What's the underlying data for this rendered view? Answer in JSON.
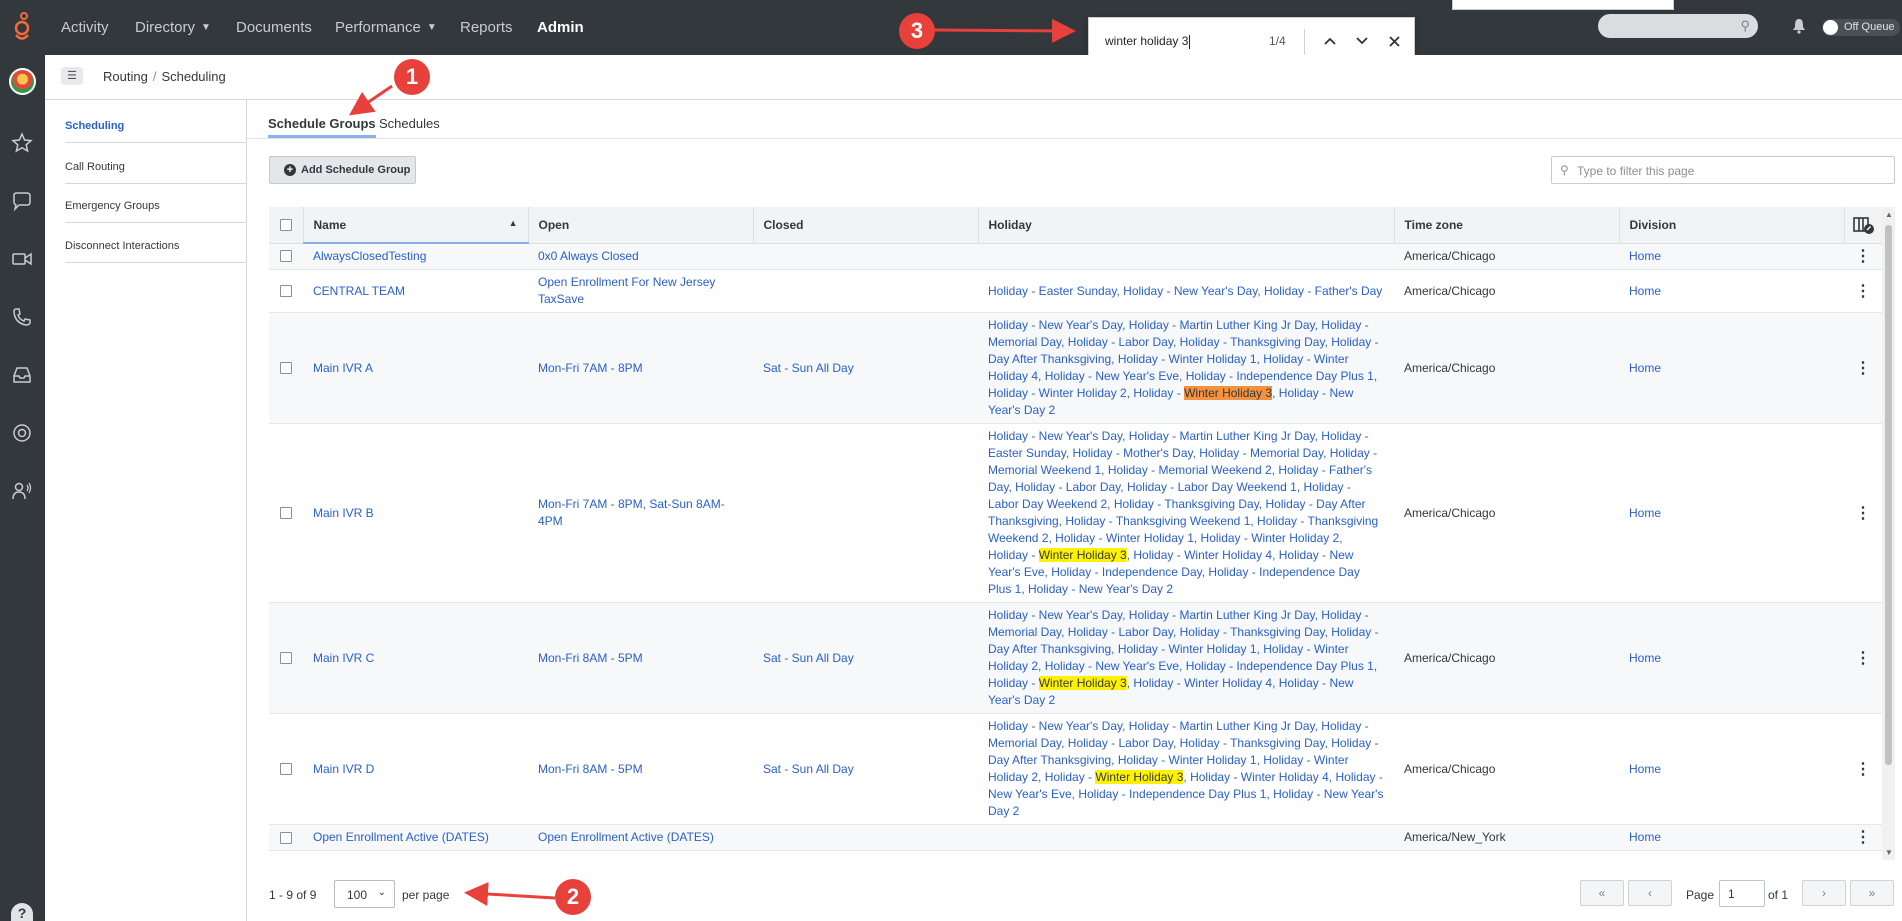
{
  "topnav": {
    "items": [
      {
        "label": "Activity",
        "has_caret": false
      },
      {
        "label": "Directory",
        "has_caret": true
      },
      {
        "label": "Documents",
        "has_caret": false
      },
      {
        "label": "Performance",
        "has_caret": true
      },
      {
        "label": "Reports",
        "has_caret": false
      },
      {
        "label": "Admin",
        "has_caret": false,
        "active": true
      }
    ],
    "queue_toggle_label": "Off Queue"
  },
  "find_bar": {
    "query": "winter holiday 3",
    "match_count": "1/4",
    "icons": [
      "chevron-up-icon",
      "chevron-down-icon",
      "close-icon"
    ]
  },
  "left_rail_icons": [
    "star-icon",
    "chat-icon",
    "video-icon",
    "phone-icon",
    "inbox-icon",
    "lifebuoy-icon",
    "user-voice-icon",
    "help-icon"
  ],
  "breadcrumb": [
    "Routing",
    "Scheduling"
  ],
  "sidenav": {
    "items": [
      {
        "label": "Scheduling",
        "active": true
      },
      {
        "label": "Call Routing"
      },
      {
        "label": "Emergency Groups"
      },
      {
        "label": "Disconnect Interactions"
      }
    ]
  },
  "tabs": [
    {
      "label": "Schedule Groups",
      "active": true
    },
    {
      "label": "Schedules"
    }
  ],
  "toolbar": {
    "add_label": "Add Schedule Group",
    "filter_placeholder": "Type to filter this page"
  },
  "table": {
    "columns": [
      "Name",
      "Open",
      "Closed",
      "Holiday",
      "Time zone",
      "Division"
    ],
    "rows": [
      {
        "name": "AlwaysClosedTesting",
        "open": "0x0 Always Closed",
        "closed": "",
        "holiday": [
          ""
        ],
        "timezone": "America/Chicago",
        "division": "Home"
      },
      {
        "name": "CENTRAL TEAM",
        "open": "Open Enrollment For New Jersey TaxSave",
        "closed": "",
        "holiday": [
          "Holiday - Easter Sunday, Holiday - New Year's Day, Holiday - Father's Day"
        ],
        "timezone": "America/Chicago",
        "division": "Home"
      },
      {
        "name": "Main IVR A",
        "open": "Mon-Fri 7AM - 8PM",
        "closed": "Sat - Sun All Day",
        "holiday": [
          "Holiday - New Year's Day, Holiday - Martin Luther King Jr Day, Holiday - Memorial Day, Holiday - Labor Day, Holiday - Thanksgiving Day, Holiday - Day After Thanksgiving, Holiday - Winter Holiday 1, Holiday - Winter Holiday 4, Holiday - New Year's Eve, Holiday - Independence Day Plus 1, Holiday - Winter Holiday 2, Holiday - ",
          "Winter Holiday 3",
          ", Holiday - New Year's Day 2"
        ],
        "highlight": "current",
        "timezone": "America/Chicago",
        "division": "Home"
      },
      {
        "name": "Main IVR B",
        "open": "Mon-Fri 7AM - 8PM, Sat-Sun 8AM-4PM",
        "closed": "",
        "holiday": [
          "Holiday - New Year's Day, Holiday - Martin Luther King Jr Day, Holiday - Easter Sunday, Holiday - Mother's Day, Holiday - Memorial Day, Holiday - Memorial Weekend 1, Holiday - Memorial Weekend 2, Holiday - Father's Day, Holiday - Labor Day, Holiday - Labor Day Weekend 1, Holiday - Labor Day Weekend 2, Holiday - Thanksgiving Day, Holiday - Day After Thanksgiving, Holiday - Thanksgiving Weekend 1, Holiday - Thanksgiving Weekend 2, Holiday - Winter Holiday 1, Holiday - Winter Holiday 2, Holiday - ",
          "Winter Holiday 3",
          ", Holiday - Winter Holiday 4, Holiday - New Year's Eve, Holiday - Independence Day, Holiday - Independence Day Plus 1, Holiday - New Year's Day 2"
        ],
        "highlight": "match",
        "timezone": "America/Chicago",
        "division": "Home"
      },
      {
        "name": "Main IVR C",
        "open": "Mon-Fri 8AM - 5PM",
        "closed": "Sat - Sun All Day",
        "holiday": [
          "Holiday - New Year's Day, Holiday - Martin Luther King Jr Day, Holiday - Memorial Day, Holiday - Labor Day, Holiday - Thanksgiving Day, Holiday - Day After Thanksgiving, Holiday - Winter Holiday 1, Holiday - Winter Holiday 2, Holiday - New Year's Eve, Holiday - Independence Day Plus 1, Holiday - ",
          "Winter Holiday 3",
          ", Holiday - Winter Holiday 4, Holiday - New Year's Day 2"
        ],
        "highlight": "match",
        "timezone": "America/Chicago",
        "division": "Home"
      },
      {
        "name": "Main IVR D",
        "open": "Mon-Fri 8AM - 5PM",
        "closed": "Sat - Sun All Day",
        "holiday": [
          "Holiday - New Year's Day, Holiday - Martin Luther King Jr Day, Holiday - Memorial Day, Holiday - Labor Day, Holiday - Thanksgiving Day, Holiday - Day After Thanksgiving, Holiday - Winter Holiday 1, Holiday - Winter Holiday 2, Holiday - ",
          "Winter Holiday 3",
          ", Holiday - Winter Holiday 4, Holiday - New Year's Eve, Holiday - Independence Day Plus 1, Holiday - New Year's Day 2"
        ],
        "highlight": "match",
        "timezone": "America/Chicago",
        "division": "Home"
      },
      {
        "name": "Open Enrollment Active (DATES)",
        "open": "Open Enrollment Active (DATES)",
        "closed": "",
        "holiday": [
          ""
        ],
        "timezone": "America/New_York",
        "division": "Home"
      }
    ]
  },
  "pagination": {
    "range_text": "1 - 9 of 9",
    "per_page_value": "100",
    "per_page_label": "per page",
    "page_label": "Page",
    "page_value": "1",
    "of_label": "of 1",
    "buttons": [
      "«",
      "‹",
      "›",
      "»"
    ]
  },
  "annotations": {
    "badge_1": "1",
    "badge_2": "2",
    "badge_3": "3",
    "color": "#e8403a"
  }
}
